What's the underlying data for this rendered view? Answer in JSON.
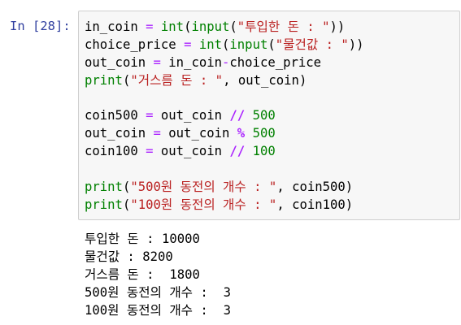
{
  "prompt": "In [28]:",
  "code_lines": [
    [
      {
        "t": "in_coin",
        "k": "name"
      },
      {
        "t": " ",
        "k": "name"
      },
      {
        "t": "=",
        "k": "op"
      },
      {
        "t": " ",
        "k": "name"
      },
      {
        "t": "int",
        "k": "builtin"
      },
      {
        "t": "(",
        "k": "name"
      },
      {
        "t": "input",
        "k": "builtin"
      },
      {
        "t": "(",
        "k": "name"
      },
      {
        "t": "\"투입한 돈 : \"",
        "k": "str"
      },
      {
        "t": "))",
        "k": "name"
      }
    ],
    [
      {
        "t": "choice_price",
        "k": "name"
      },
      {
        "t": " ",
        "k": "name"
      },
      {
        "t": "=",
        "k": "op"
      },
      {
        "t": " ",
        "k": "name"
      },
      {
        "t": "int",
        "k": "builtin"
      },
      {
        "t": "(",
        "k": "name"
      },
      {
        "t": "input",
        "k": "builtin"
      },
      {
        "t": "(",
        "k": "name"
      },
      {
        "t": "\"물건값 : \"",
        "k": "str"
      },
      {
        "t": "))",
        "k": "name"
      }
    ],
    [
      {
        "t": "out_coin",
        "k": "name"
      },
      {
        "t": " ",
        "k": "name"
      },
      {
        "t": "=",
        "k": "op"
      },
      {
        "t": " in_coin",
        "k": "name"
      },
      {
        "t": "-",
        "k": "op"
      },
      {
        "t": "choice_price",
        "k": "name"
      }
    ],
    [
      {
        "t": "print",
        "k": "builtin"
      },
      {
        "t": "(",
        "k": "name"
      },
      {
        "t": "\"거스름 돈 : \"",
        "k": "str"
      },
      {
        "t": ", out_coin)",
        "k": "name"
      }
    ],
    [],
    [
      {
        "t": "coin500",
        "k": "name"
      },
      {
        "t": " ",
        "k": "name"
      },
      {
        "t": "=",
        "k": "op"
      },
      {
        "t": " out_coin ",
        "k": "name"
      },
      {
        "t": "//",
        "k": "opw"
      },
      {
        "t": " ",
        "k": "name"
      },
      {
        "t": "500",
        "k": "num"
      }
    ],
    [
      {
        "t": "out_coin",
        "k": "name"
      },
      {
        "t": " ",
        "k": "name"
      },
      {
        "t": "=",
        "k": "op"
      },
      {
        "t": " out_coin ",
        "k": "name"
      },
      {
        "t": "%",
        "k": "opw"
      },
      {
        "t": " ",
        "k": "name"
      },
      {
        "t": "500",
        "k": "num"
      }
    ],
    [
      {
        "t": "coin100",
        "k": "name"
      },
      {
        "t": " ",
        "k": "name"
      },
      {
        "t": "=",
        "k": "op"
      },
      {
        "t": " out_coin ",
        "k": "name"
      },
      {
        "t": "//",
        "k": "opw"
      },
      {
        "t": " ",
        "k": "name"
      },
      {
        "t": "100",
        "k": "num"
      }
    ],
    [],
    [
      {
        "t": "print",
        "k": "builtin"
      },
      {
        "t": "(",
        "k": "name"
      },
      {
        "t": "\"500원 동전의 개수 : \"",
        "k": "str"
      },
      {
        "t": ", coin500)",
        "k": "name"
      }
    ],
    [
      {
        "t": "print",
        "k": "builtin"
      },
      {
        "t": "(",
        "k": "name"
      },
      {
        "t": "\"100원 동전의 개수 : \"",
        "k": "str"
      },
      {
        "t": ", coin100)",
        "k": "name"
      }
    ]
  ],
  "output_lines": [
    "투입한 돈 : 10000",
    "물건값 : 8200",
    "거스름 돈 :  1800",
    "500원 동전의 개수 :  3",
    "100원 동전의 개수 :  3"
  ],
  "colors": {
    "prompt": "#303f9f",
    "operator": "#aa22ff",
    "builtin": "#008000",
    "string": "#ba2121",
    "number": "#008000",
    "input_background": "#f7f7f7",
    "input_border": "#cfcfcf"
  }
}
